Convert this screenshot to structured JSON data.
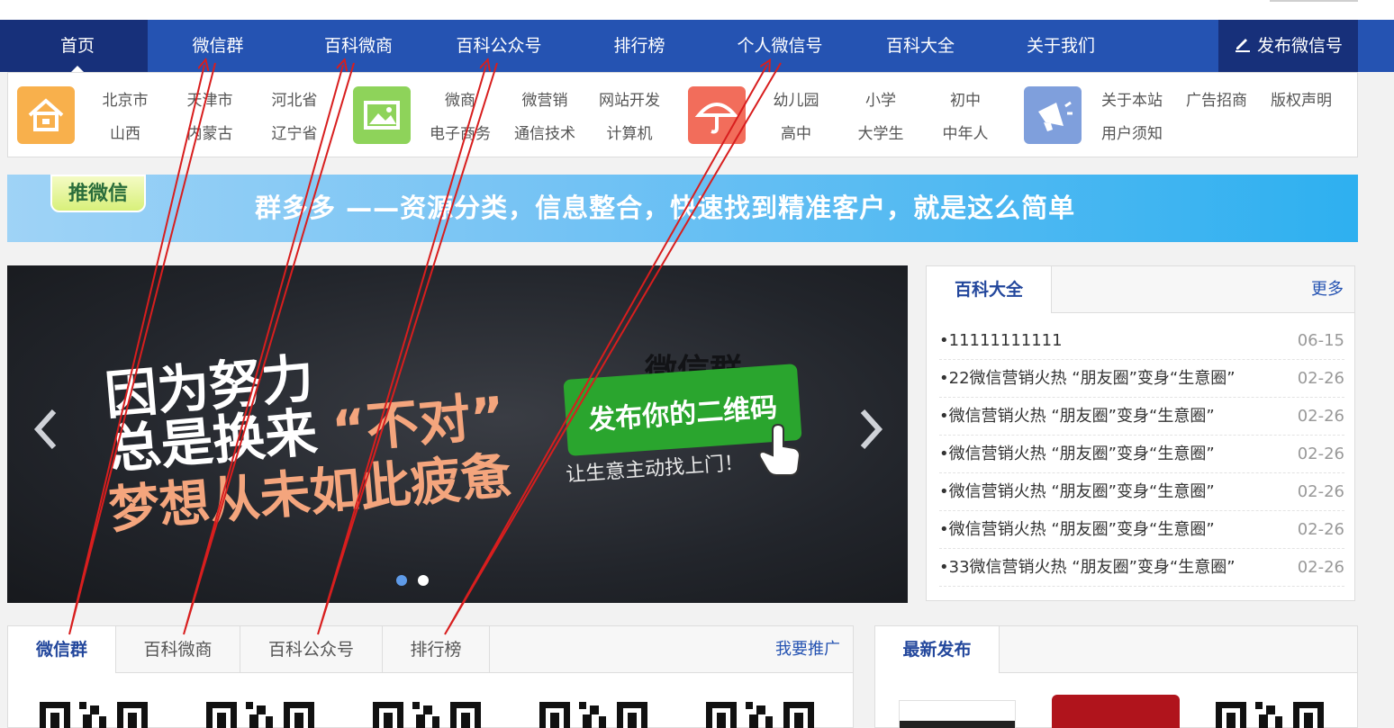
{
  "nav": {
    "items": [
      {
        "label": "首页"
      },
      {
        "label": "微信群"
      },
      {
        "label": "百科微商"
      },
      {
        "label": "百科公众号"
      },
      {
        "label": "排行榜"
      },
      {
        "label": "个人微信号"
      },
      {
        "label": "百科大全"
      },
      {
        "label": "关于我们"
      }
    ],
    "publish_label": "发布微信号"
  },
  "categories": {
    "group1": [
      "北京市",
      "天津市",
      "河北省",
      "山西",
      "内蒙古",
      "辽宁省"
    ],
    "group2": [
      "微商",
      "微营销",
      "网站开发",
      "电子商务",
      "通信技术",
      "计算机"
    ],
    "group3": [
      "幼儿园",
      "小学",
      "初中",
      "高中",
      "大学生",
      "中年人"
    ],
    "group4": [
      "关于本站",
      "广告招商",
      "版权声明",
      "用户须知"
    ]
  },
  "banner": {
    "badge": "推微信",
    "slogan": "群多多 ——资源分类，信息整合，快速找到精准客户，就是这么简单"
  },
  "slider": {
    "line1": "因为努力",
    "line2": "总是换来",
    "quote": "“不对”",
    "line3": "梦想从未如此疲惫",
    "watermark": "微信群",
    "cta": "发布你的二维码",
    "subtitle": "让生意主动找上门！"
  },
  "side": {
    "tab": "百科大全",
    "more": "更多",
    "news": [
      {
        "title": "•11111111111",
        "date": "06-15"
      },
      {
        "title": "•22微信营销火热 “朋友圈”变身“生意圈”",
        "date": "02-26"
      },
      {
        "title": "•微信营销火热 “朋友圈”变身“生意圈”",
        "date": "02-26"
      },
      {
        "title": "•微信营销火热 “朋友圈”变身“生意圈”",
        "date": "02-26"
      },
      {
        "title": "•微信营销火热 “朋友圈”变身“生意圈”",
        "date": "02-26"
      },
      {
        "title": "•微信营销火热 “朋友圈”变身“生意圈”",
        "date": "02-26"
      },
      {
        "title": "•33微信营销火热 “朋友圈”变身“生意圈”",
        "date": "02-26"
      }
    ]
  },
  "bottom_left": {
    "tabs": [
      {
        "label": "微信群"
      },
      {
        "label": "百科微商"
      },
      {
        "label": "百科公众号"
      },
      {
        "label": "排行榜"
      }
    ],
    "promo": "我要推广"
  },
  "bottom_right": {
    "tab": "最新发布"
  },
  "colors": {
    "nav_bg": "#2553b2",
    "nav_active": "#17307a",
    "annotation": "#d81e1e"
  }
}
